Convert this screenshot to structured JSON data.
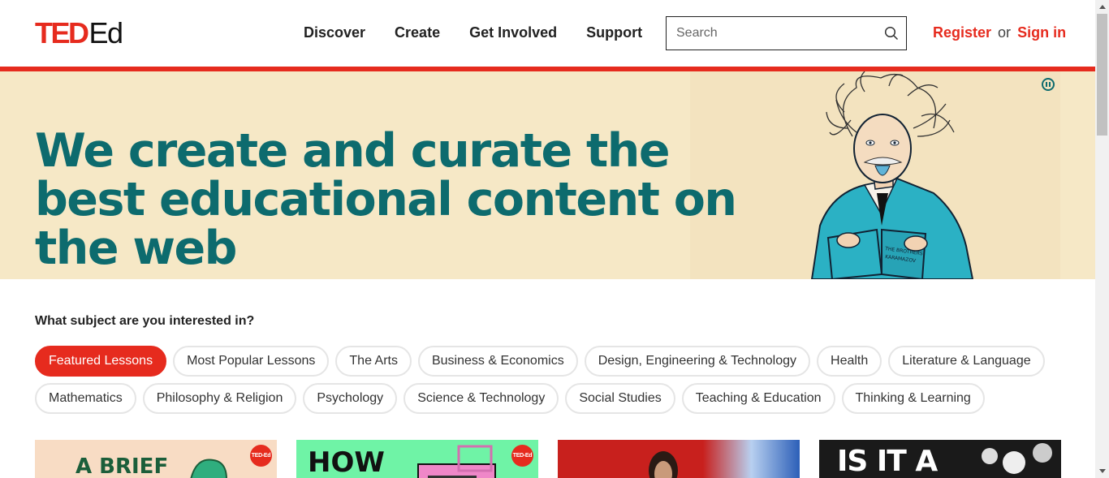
{
  "header": {
    "logo_ted": "TED",
    "logo_ed": "Ed",
    "nav": [
      "Discover",
      "Create",
      "Get Involved",
      "Support"
    ],
    "search_placeholder": "Search",
    "register": "Register",
    "or": "or",
    "signin": "Sign in"
  },
  "hero": {
    "title": "We create and curate the best educational content on the web",
    "book_text": "THE BROTHERS KARAMAZOV"
  },
  "subjects": {
    "question": "What subject are you interested in?",
    "chips": [
      "Featured Lessons",
      "Most Popular Lessons",
      "The Arts",
      "Business & Economics",
      "Design, Engineering & Technology",
      "Health",
      "Literature & Language",
      "Mathematics",
      "Philosophy & Religion",
      "Psychology",
      "Science & Technology",
      "Social Studies",
      "Teaching & Education",
      "Thinking & Learning"
    ],
    "active_index": 0
  },
  "cards": [
    {
      "caption": "A BRIEF",
      "badge": "TED-Ed",
      "bg": "#f8dcc4",
      "fg": "#1b5e3a"
    },
    {
      "caption": "HOW",
      "badge": "TED-Ed",
      "bg": "#6ff3a6",
      "fg": "#111111"
    },
    {
      "caption": "",
      "badge": "",
      "bg": "#c8201d",
      "fg": "#ffffff"
    },
    {
      "caption": "IS IT A",
      "badge": "",
      "bg": "#1a1a1a",
      "fg": "#ffffff"
    }
  ],
  "colors": {
    "brand_red": "#e62b1e",
    "hero_bg": "#f6e8c6",
    "hero_text": "#0d6b6e"
  }
}
